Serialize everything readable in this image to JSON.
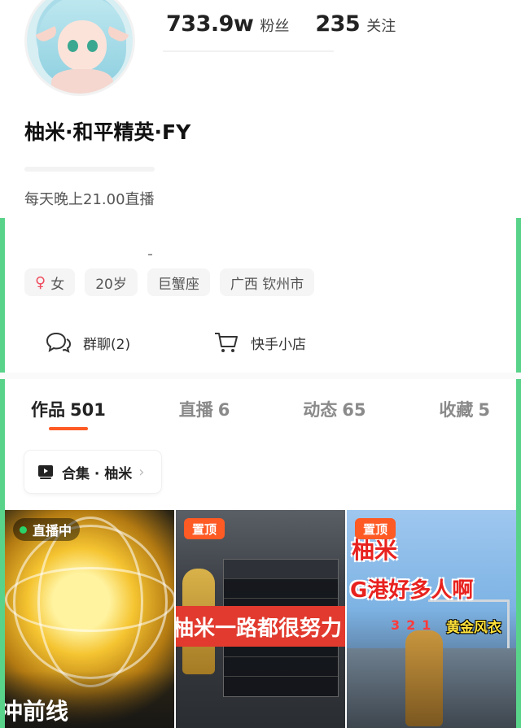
{
  "stats": {
    "followers_value": "733.9w",
    "followers_label": "粉丝",
    "following_value": "235",
    "following_label": "关注"
  },
  "profile": {
    "name": "柚米·和平精英·FY",
    "bio": "每天晚上21.00直播"
  },
  "tags": {
    "gender_symbol": "♀",
    "gender": "女",
    "age": "20岁",
    "zodiac": "巨蟹座",
    "location": "广西 钦州市"
  },
  "actions": {
    "group_chat": "群聊(2)",
    "shop": "快手小店"
  },
  "tabs": [
    {
      "label": "作品",
      "count": "501"
    },
    {
      "label": "直播",
      "count": "6"
    },
    {
      "label": "动态",
      "count": "65"
    },
    {
      "label": "收藏",
      "count": "5"
    }
  ],
  "collection": {
    "label": "合集 · 柚米",
    "chevron": "›"
  },
  "grid": [
    {
      "badge": "直播中",
      "caption": "冲前线"
    },
    {
      "badge": "置顶",
      "caption": "柚米一路都很努力"
    },
    {
      "badge": "置顶",
      "title1": "柚米",
      "title2": "G港好多人啊",
      "nums": "321",
      "sub": "黄金风衣"
    }
  ],
  "colors": {
    "accent": "#fe5a24",
    "live_dot": "#29d36a",
    "female": "#ef4d5f"
  }
}
